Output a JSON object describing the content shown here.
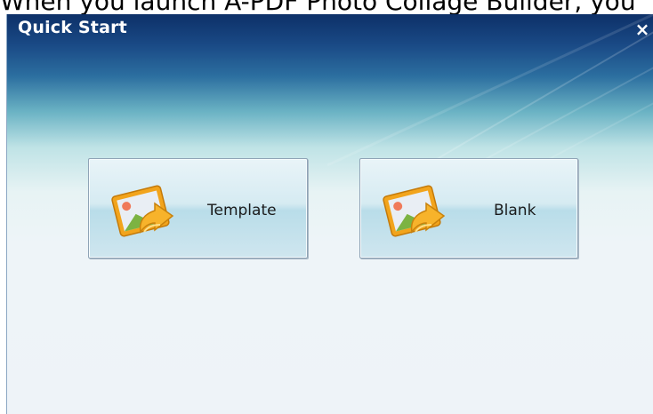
{
  "caption": "When you launch A-PDF Photo Collage Builder, you",
  "window": {
    "title": "Quick Start",
    "close_glyph": "×",
    "close_icon": "close-icon"
  },
  "buttons": [
    {
      "label": "Template",
      "icon": "photo-folder-icon"
    },
    {
      "label": "Blank",
      "icon": "photo-folder-icon"
    }
  ],
  "colors": {
    "title_bar": "#0d3068",
    "body": "#eef4f8",
    "button_face": "#cfe6ef",
    "icon_frame": "#f2a41c"
  }
}
